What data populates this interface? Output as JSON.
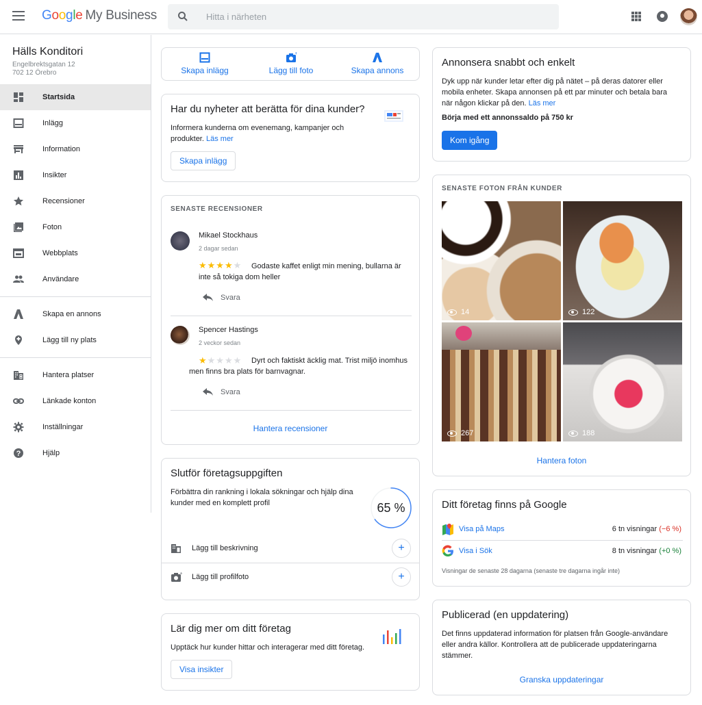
{
  "header": {
    "logo_letters": [
      "G",
      "o",
      "o",
      "g",
      "l",
      "e"
    ],
    "product": "My Business",
    "search_placeholder": "Hitta i närheten"
  },
  "business": {
    "name": "Hälls Konditori",
    "address_line1": "Engelbrektsgatan 12",
    "address_line2": "702 12 Örebro"
  },
  "sidebar": {
    "items": [
      {
        "label": "Startsida",
        "icon": "dashboard-icon"
      },
      {
        "label": "Inlägg",
        "icon": "posts-icon"
      },
      {
        "label": "Information",
        "icon": "storefront-icon"
      },
      {
        "label": "Insikter",
        "icon": "insights-icon"
      },
      {
        "label": "Recensioner",
        "icon": "star-icon"
      },
      {
        "label": "Foton",
        "icon": "photos-icon"
      },
      {
        "label": "Webbplats",
        "icon": "website-icon"
      },
      {
        "label": "Användare",
        "icon": "users-icon"
      },
      {
        "label": "Skapa en annons",
        "icon": "ads-icon"
      },
      {
        "label": "Lägg till ny plats",
        "icon": "location-icon"
      },
      {
        "label": "Hantera platser",
        "icon": "buildings-icon"
      },
      {
        "label": "Länkade konton",
        "icon": "link-icon"
      },
      {
        "label": "Inställningar",
        "icon": "gear-icon"
      },
      {
        "label": "Hjälp",
        "icon": "help-icon"
      }
    ]
  },
  "quick_actions": {
    "create_post": "Skapa inlägg",
    "add_photo": "Lägg till foto",
    "create_ad": "Skapa annons"
  },
  "news_card": {
    "title": "Har du nyheter att berätta för dina kunder?",
    "text": "Informera kunderna om evenemang, kampanjer och produkter.",
    "link": "Läs mer",
    "button": "Skapa inlägg"
  },
  "reviews": {
    "overline": "SENASTE RECENSIONER",
    "items": [
      {
        "name": "Mikael Stockhaus",
        "time": "2 dagar sedan",
        "rating": 4,
        "text": "Godaste kaffet enligt min mening, bullarna är inte så tokiga dom heller",
        "reply": "Svara"
      },
      {
        "name": "Spencer Hastings",
        "time": "2 veckor sedan",
        "rating": 1,
        "text": "Dyrt och faktiskt äcklig mat. Trist miljö inomhus men finns bra plats för barnvagnar.",
        "reply": "Svara"
      }
    ],
    "manage": "Hantera recensioner"
  },
  "profile_card": {
    "title": "Slutför företagsuppgiften",
    "text": "Förbättra din rankning i lokala sökningar och hjälp dina kunder med en komplett profil",
    "percent_label": "65 %",
    "percent": 65,
    "tasks": [
      {
        "label": "Lägg till beskrivning",
        "icon": "building-icon"
      },
      {
        "label": "Lägg till profilfoto",
        "icon": "add-photo-icon"
      }
    ]
  },
  "learn_card": {
    "title": "Lär dig mer om ditt företag",
    "text": "Upptäck hur kunder hittar och interagerar med ditt företag.",
    "button": "Visa insikter"
  },
  "ads_card": {
    "title": "Annonsera snabbt och enkelt",
    "text": "Dyk upp när kunder letar efter dig på nätet – på deras datorer eller mobila enheter. Skapa annonsen på ett par minuter och betala bara när någon klickar på den.",
    "link": "Läs mer",
    "budget": "Börja med ett annonssaldo på 750 kr",
    "button": "Kom igång"
  },
  "photos_card": {
    "overline": "SENASTE FOTON FRÅN KUNDER",
    "photos": [
      {
        "views": "14"
      },
      {
        "views": "122"
      },
      {
        "views": "267"
      },
      {
        "views": "188"
      }
    ],
    "manage": "Hantera foton"
  },
  "google_card": {
    "title": "Ditt företag finns på Google",
    "rows": [
      {
        "label": "Visa på Maps",
        "views": "6 tn visningar",
        "change": "(−6 %)",
        "change_color": "#d93025"
      },
      {
        "label": "Visa i Sök",
        "views": "8 tn visningar",
        "change": "(+0 %)",
        "change_color": "#188038"
      }
    ],
    "footnote": "Visningar de senaste 28 dagarna (senaste tre dagarna ingår inte)"
  },
  "published_card": {
    "title": "Publicerad (en uppdatering)",
    "text": "Det finns uppdaterad information för platsen från Google-användare eller andra källor. Kontrollera att de publicerade uppdateringarna stämmer.",
    "button": "Granska uppdateringar"
  }
}
